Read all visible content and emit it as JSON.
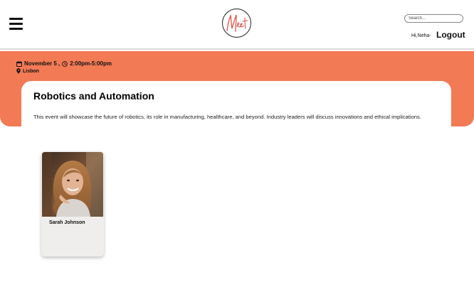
{
  "header": {
    "search_placeholder": "Search...",
    "greeting": "Hi,Neha-",
    "logout_label": "Logout",
    "logo_text": "Meet"
  },
  "event": {
    "date": "November 5 ,",
    "time": "2:00pm-5:00pm",
    "location": "Lisbon",
    "title": "Robotics and Automation",
    "description": "This event will showcase the future of robotics, its role in manufacturing, healthcare, and beyond. Industry leaders will discuss innovations and ethical implications."
  },
  "speakers": [
    {
      "name": "Sarah Johnson"
    }
  ],
  "colors": {
    "accent": "#f27a55",
    "logo_script": "#e0524a"
  },
  "icons": {
    "menu": "hamburger-menu-icon",
    "calendar": "calendar-icon",
    "clock": "clock-icon",
    "location": "map-pin-icon"
  }
}
